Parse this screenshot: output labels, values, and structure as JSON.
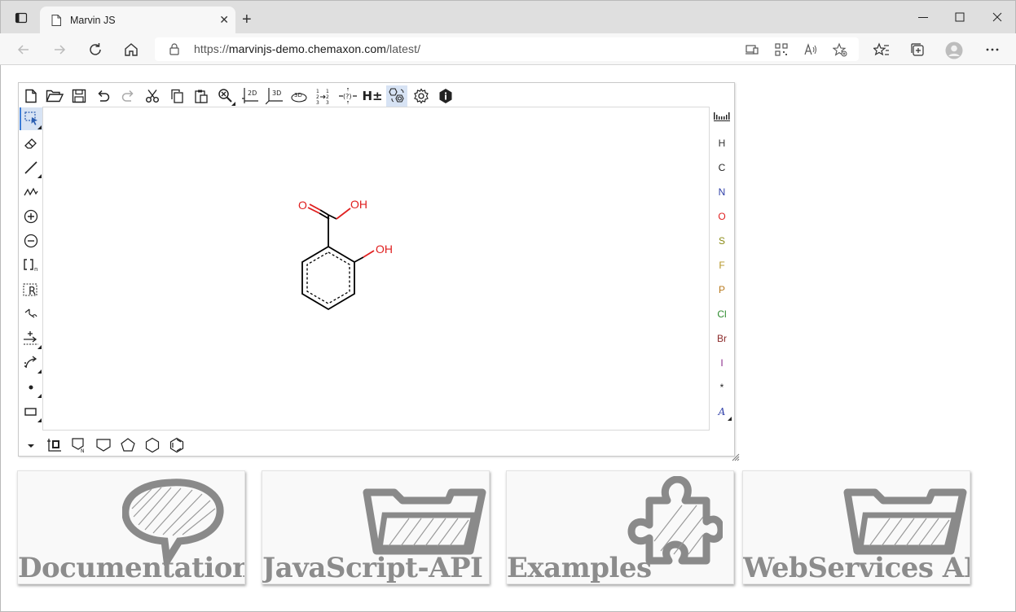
{
  "browser": {
    "tab_title": "Marvin JS",
    "url_scheme": "https://",
    "url_host": "marvinjs-demo.chemaxon.com",
    "url_path": "/latest/"
  },
  "molecule": {
    "atom_labels": [
      "O",
      "OH",
      "OH"
    ],
    "colors": {
      "bond": "#000000",
      "oxygen": "#e02020"
    }
  },
  "element_bar": {
    "items": [
      {
        "symbol": "H",
        "color": "#333333"
      },
      {
        "symbol": "C",
        "color": "#222222"
      },
      {
        "symbol": "N",
        "color": "#2f3fa8"
      },
      {
        "symbol": "O",
        "color": "#e02020"
      },
      {
        "symbol": "S",
        "color": "#8a8a14"
      },
      {
        "symbol": "F",
        "color": "#b59425"
      },
      {
        "symbol": "P",
        "color": "#b87a1e"
      },
      {
        "symbol": "Cl",
        "color": "#2e8b2e"
      },
      {
        "symbol": "Br",
        "color": "#8b2a2a"
      },
      {
        "symbol": "I",
        "color": "#8a2a8a"
      },
      {
        "symbol": "*",
        "color": "#222222"
      },
      {
        "symbol": "A",
        "color": "#2f3fa8"
      }
    ]
  },
  "toolbar": {
    "h_toggle": "H±",
    "clean_2d": "2D",
    "clean_3d": "3D",
    "view_3d": "3D",
    "rgroup": "R",
    "sgroup_n": "n"
  },
  "cards": [
    {
      "label": "Documentation"
    },
    {
      "label": "JavaScript-API"
    },
    {
      "label": "Examples"
    },
    {
      "label": "WebServices API"
    }
  ]
}
